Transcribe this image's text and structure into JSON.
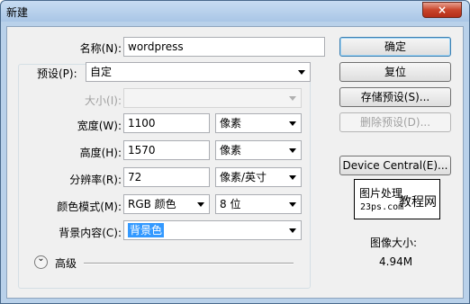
{
  "window": {
    "title": "新建",
    "close_icon": "×"
  },
  "fields": {
    "name": {
      "label": "名称(N):",
      "value": "wordpress"
    },
    "preset": {
      "label": "预设(P):",
      "value": "自定"
    },
    "size": {
      "label": "大小(I):",
      "value": ""
    },
    "width": {
      "label": "宽度(W):",
      "value": "1100",
      "unit": "像素"
    },
    "height": {
      "label": "高度(H):",
      "value": "1570",
      "unit": "像素"
    },
    "resolution": {
      "label": "分辨率(R):",
      "value": "72",
      "unit": "像素/英寸"
    },
    "color_mode": {
      "label": "颜色模式(M):",
      "value": "RGB 颜色",
      "depth": "8 位"
    },
    "background": {
      "label": "背景内容(C):",
      "value": "背景色"
    }
  },
  "advanced": {
    "label": "高级",
    "icon": "double-chevron-down-icon"
  },
  "buttons": {
    "ok": "确定",
    "reset": "复位",
    "save_preset": "存储预设(S)...",
    "delete_preset": "删除预设(D)...",
    "device_central": "Device Central(E)..."
  },
  "watermark": {
    "top": "图片处理",
    "bottom": "23ps.com",
    "right": "教程网"
  },
  "image_size": {
    "label": "图像大小:",
    "value": "4.94M"
  },
  "colors": {
    "title_bar": "#b9d1ea",
    "selection": "#3399ff",
    "close_button": "#c9452b"
  }
}
